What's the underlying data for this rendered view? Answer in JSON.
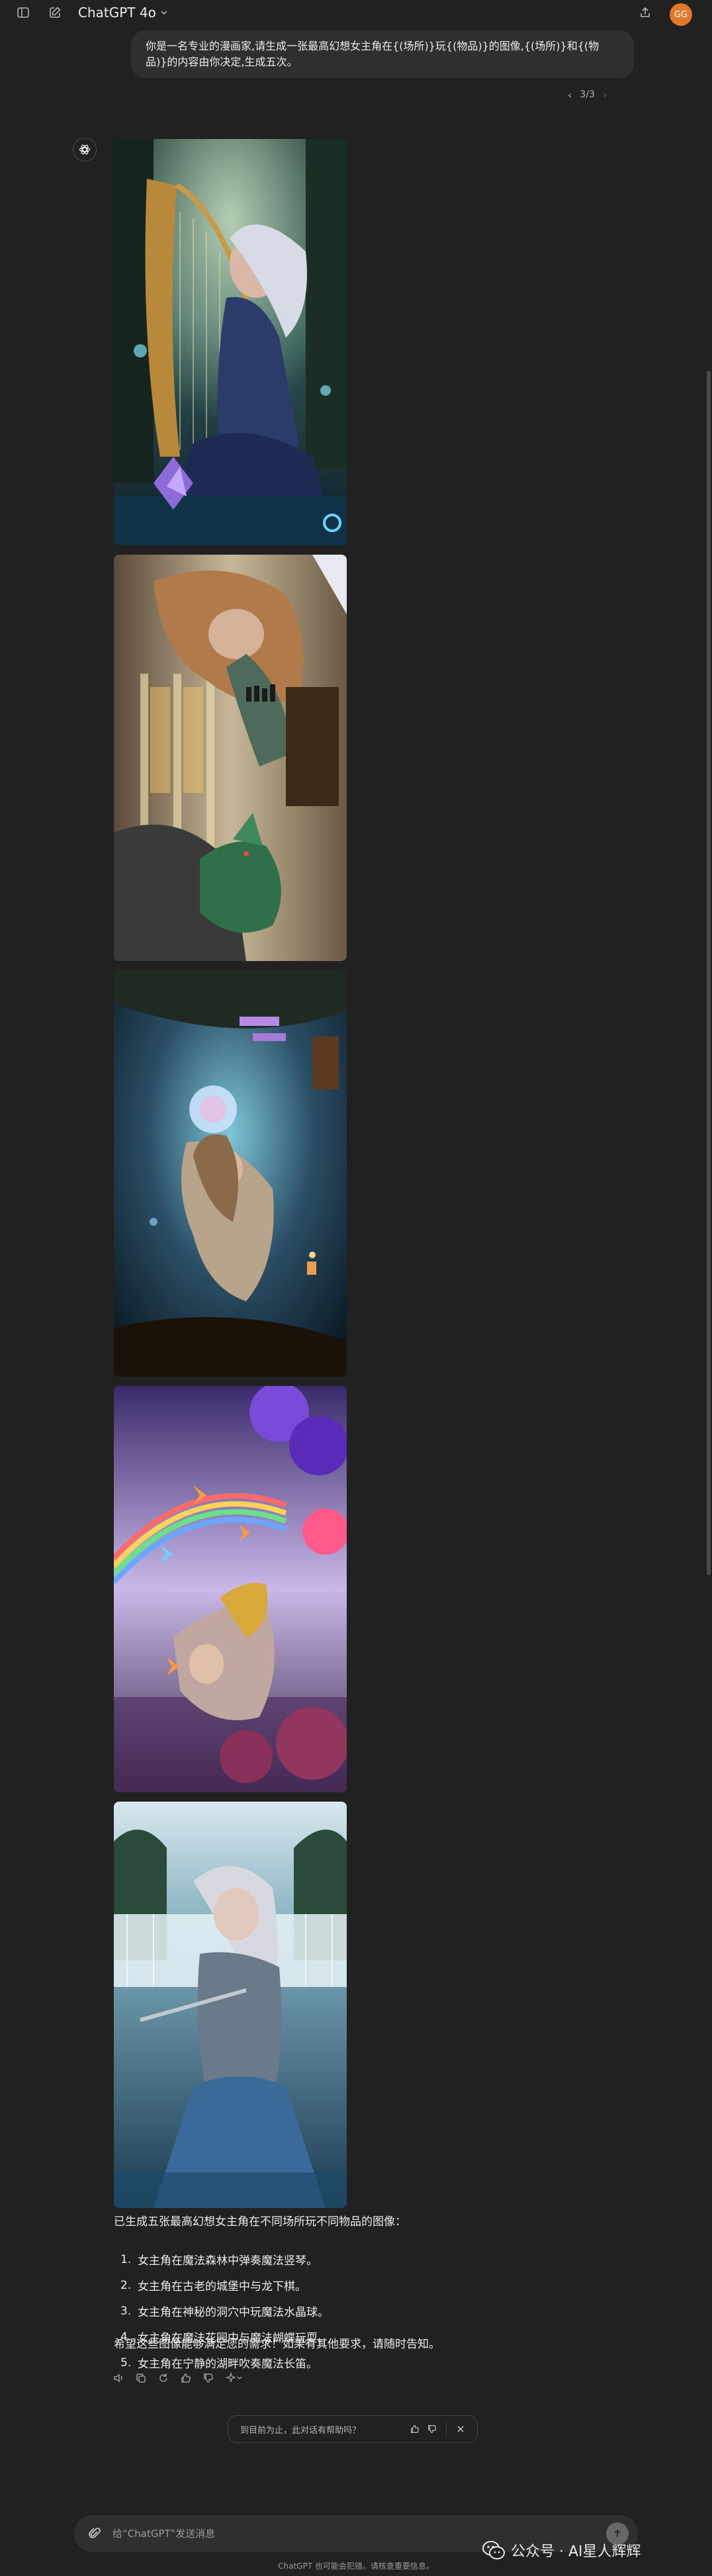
{
  "header": {
    "model_name": "ChatGPT 4o",
    "avatar_initials": "GG",
    "avatar_color": "#e07a2a"
  },
  "conversation": {
    "user_prompt": "你是一名专业的漫画家,请生成一张最高幻想女主角在{(场所)}玩{(物品)}的图像,{(场所)}和{(物品)}的内容由你决定,生成五次。",
    "pager": {
      "current": "3/3",
      "prev_icon": "chevron-left-icon",
      "next_icon": "chevron-right-icon"
    },
    "assistant": {
      "intro": "已生成五张最高幻想女主角在不同场所玩不同物品的图像：",
      "items": [
        {
          "num": "1.",
          "text": "女主角在魔法森林中弹奏魔法竖琴。"
        },
        {
          "num": "2.",
          "text": "女主角在古老的城堡中与龙下棋。"
        },
        {
          "num": "3.",
          "text": "女主角在神秘的洞穴中玩魔法水晶球。"
        },
        {
          "num": "4.",
          "text": "女主角在魔法花园中与魔法蝴蝶玩耍。"
        },
        {
          "num": "5.",
          "text": "女主角在宁静的湖畔吹奏魔法长笛。"
        }
      ],
      "closing": "希望这些图像能够满足您的需求！如果有其他要求，请随时告知。"
    }
  },
  "feedback": {
    "question": "到目前为止，此对话有帮助吗？"
  },
  "composer": {
    "placeholder": "给“ChatGPT”发送消息",
    "disclaimer": "ChatGPT 也可能会犯错。请核查重要信息。"
  },
  "watermark": {
    "text": "公众号 · AI星人辉辉"
  }
}
